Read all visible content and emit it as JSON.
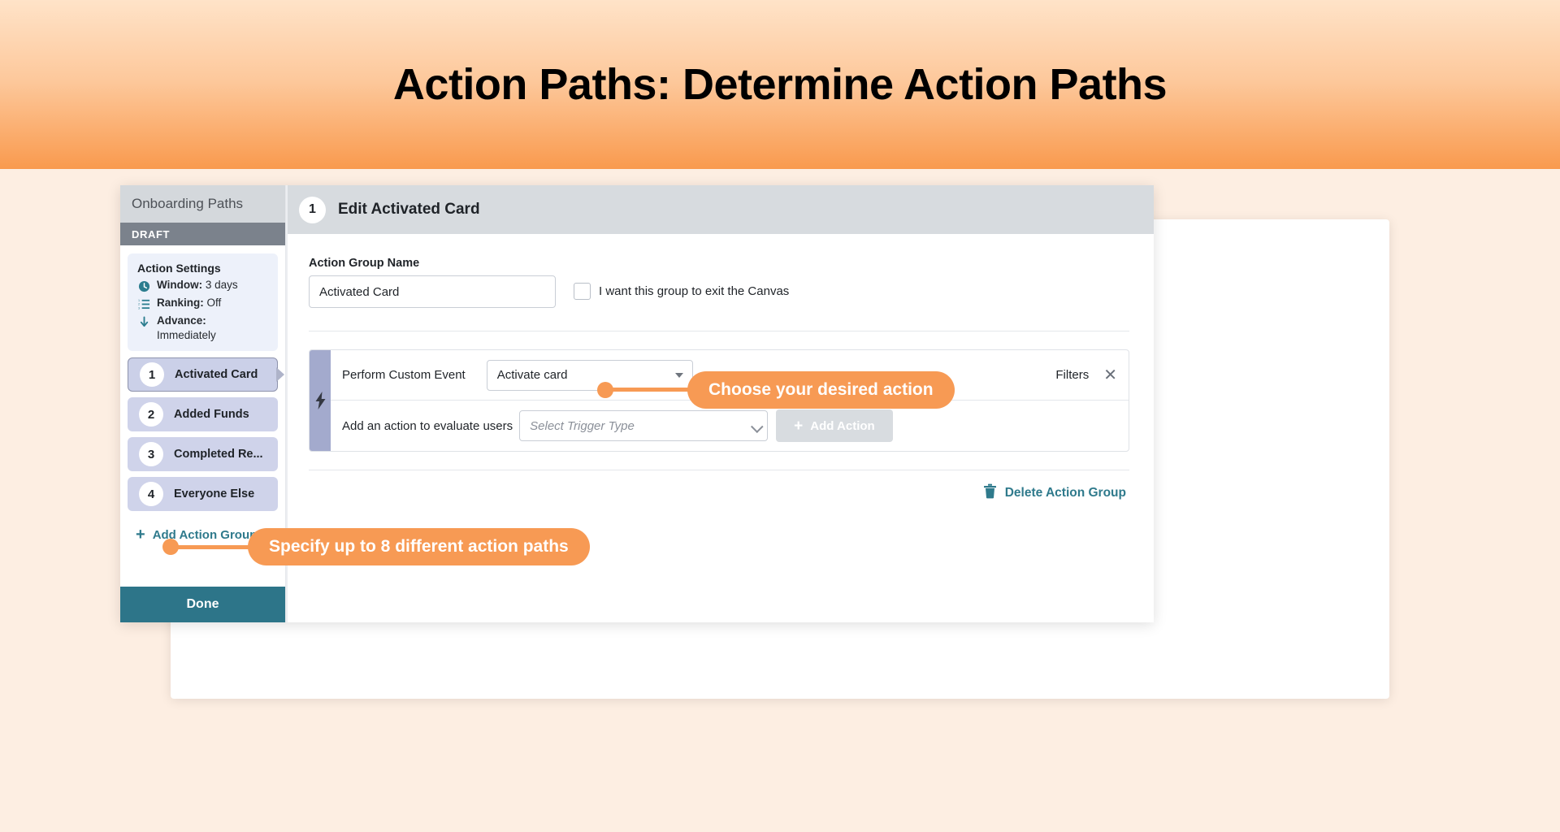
{
  "banner": {
    "title": "Action Paths: Determine Action Paths"
  },
  "sidebar": {
    "title": "Onboarding Paths",
    "status": "DRAFT",
    "settings": {
      "heading": "Action Settings",
      "rows": [
        {
          "icon": "clock-icon",
          "label": "Window:",
          "value": "3 days"
        },
        {
          "icon": "ranking-list-icon",
          "label": "Ranking:",
          "value": "Off"
        },
        {
          "icon": "down-arrow-icon",
          "label": "Advance:",
          "value": "Immediately"
        }
      ]
    },
    "groups": [
      {
        "number": "1",
        "label": "Activated Card",
        "selected": true,
        "warning": false
      },
      {
        "number": "2",
        "label": "Added Funds",
        "selected": false,
        "warning": false
      },
      {
        "number": "3",
        "label": "Completed Re...",
        "selected": false,
        "warning": false
      },
      {
        "number": "4",
        "label": "Everyone Else",
        "selected": false,
        "warning": true,
        "warning_glyph": "!"
      }
    ],
    "add_group_label": "Add Action Group",
    "add_group_icon": "plus-icon",
    "done_label": "Done"
  },
  "content": {
    "header": {
      "number": "1",
      "title": "Edit Activated Card"
    },
    "group_name": {
      "label": "Action Group Name",
      "value": "Activated Card",
      "placeholder": "Action Group Name"
    },
    "exit_canvas": {
      "label": "I want this group to exit the Canvas",
      "checked": false
    },
    "action_card": {
      "rail_icon": "lightning-bolt-icon",
      "row1": {
        "label": "Perform Custom Event",
        "select_value": "Activate card",
        "select_icon": "caret-down-icon"
      },
      "row2": {
        "label": "Add an action to evaluate users",
        "select_placeholder": "Select Trigger Type",
        "select_icon": "chevron-down-icon",
        "add_action_label": "Add Action",
        "add_action_icon": "plus-icon"
      },
      "filters_label": "Filters",
      "close_icon": "close-icon"
    },
    "delete": {
      "label": "Delete Action Group",
      "icon": "trash-icon"
    }
  },
  "callouts": [
    {
      "id": "choose-action",
      "text": "Choose your desired action"
    },
    {
      "id": "specify-paths",
      "text": "Specify up to 8 different action paths"
    }
  ],
  "ghost": {
    "number": "4",
    "label": "Everyone Else",
    "warning_glyph": "!"
  },
  "colors": {
    "accent_orange": "#f79a54",
    "teal": "#2f7a8c",
    "draft_gray": "#7b828c",
    "group_bg": "#cfd3ea"
  }
}
